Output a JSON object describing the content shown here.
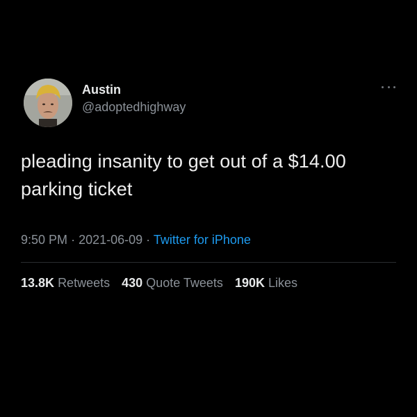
{
  "tweet": {
    "author": {
      "display_name": "Austin",
      "handle": "@adoptedhighway"
    },
    "text_line1": "pleading insanity to get out of a $14.00",
    "text_line2": "parking ticket",
    "time": "9:50 PM",
    "separator": "·",
    "date": "2021-06-09",
    "source": "Twitter for iPhone",
    "stats": {
      "retweets": {
        "count": "13.8K",
        "label": "Retweets"
      },
      "quote_tweets": {
        "count": "430",
        "label": "Quote Tweets"
      },
      "likes": {
        "count": "190K",
        "label": "Likes"
      }
    }
  },
  "icons": {
    "avatar": "profile-photo",
    "more": "more-options-icon"
  },
  "colors": {
    "background": "#000000",
    "primary_text": "#e7e9ea",
    "secondary_text": "#8b9198",
    "link": "#1d9bf0",
    "divider": "#2a2d30"
  }
}
